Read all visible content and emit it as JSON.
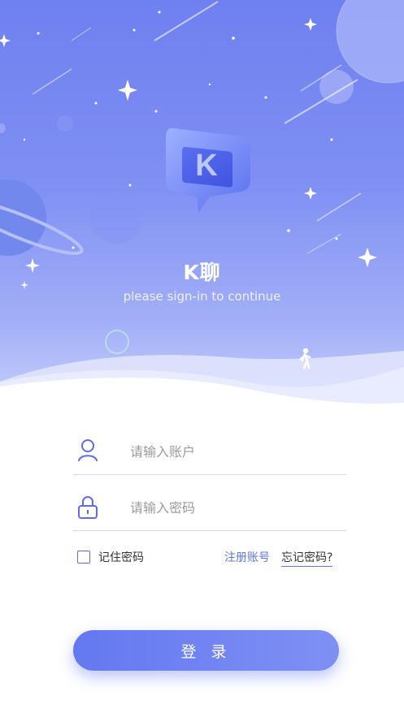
{
  "app": {
    "name": "K聊",
    "tagline": "please sign-in to continue",
    "logo_letter": "K"
  },
  "login_form": {
    "account_placeholder": "请输入账户",
    "password_placeholder": "请输入密码",
    "remember_label": "记住密码",
    "register_label": "注册账号",
    "forgot_label": "忘记密码?",
    "login_button": "登 录"
  },
  "icons": {
    "account": "user-icon",
    "password": "lock-icon",
    "logo": "chat-bubble-logo",
    "walker": "walking-person-icon"
  },
  "colors": {
    "accent": "#6478f0",
    "hero_top": "#6f80f0",
    "hero_bottom": "#c7cffb",
    "link": "#5f74ea"
  }
}
